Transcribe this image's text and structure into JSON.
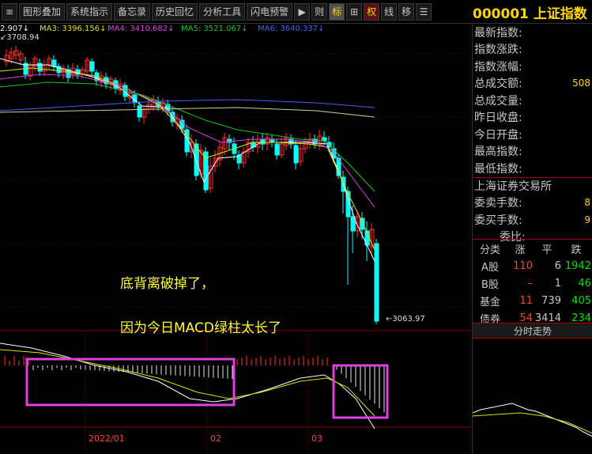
{
  "toolbar": {
    "buttons": [
      "图形叠加",
      "系统指示",
      "备忘录",
      "历史回忆",
      "分析工具",
      "闪电预警"
    ],
    "icons": {
      "play": "▶",
      "menu": "≡",
      "plus": "⊞",
      "list": "☰"
    },
    "mini_buttons": [
      "则",
      "标",
      "权",
      "线",
      "移"
    ],
    "index_title": "000001 上证指数"
  },
  "ma_bar": {
    "items": [
      {
        "label": "2.907↓",
        "color": "#ffffff"
      },
      {
        "label": "MA3: 3396.156↓",
        "color": "#e0e000"
      },
      {
        "label": "MA4: 3410.682↓",
        "color": "#e040e0"
      },
      {
        "label": "MA5: 3521.067↓",
        "color": "#20c020"
      },
      {
        "label": "MA6: 3640.337↓",
        "color": "#4060ff"
      }
    ],
    "price_tag": "3708.94",
    "low_tag": "3063.97"
  },
  "annotations": {
    "line1": "底背离破掉了，",
    "line2": "因为今日MACD绿柱太长了"
  },
  "dates": [
    "2022/01",
    "02",
    "03"
  ],
  "quote_panel": {
    "rows": [
      {
        "label": "最新指数:",
        "value": ""
      },
      {
        "label": "指数涨跌:",
        "value": ""
      },
      {
        "label": "指数涨幅:",
        "value": ""
      },
      {
        "label": "总成交额:",
        "value": "508"
      },
      {
        "label": "总成交量:",
        "value": ""
      },
      {
        "label": "昨日收盘:",
        "value": ""
      },
      {
        "label": "今日开盘:",
        "value": ""
      },
      {
        "label": "最高指数:",
        "value": ""
      },
      {
        "label": "最低指数:",
        "value": ""
      }
    ],
    "exchange": "上海证券交易所",
    "rows2": [
      {
        "label": "委卖手数:",
        "value": "8"
      },
      {
        "label": "委买手数:",
        "value": "9"
      },
      {
        "label": "委比:",
        "value": ""
      }
    ]
  },
  "rise_fall_table": {
    "headers": [
      "分类",
      "涨",
      "平",
      "跌"
    ],
    "rows": [
      [
        "A股",
        "110",
        "6",
        "1942"
      ],
      [
        "B股",
        "–",
        "1",
        "46"
      ],
      [
        "基金",
        "11",
        "739",
        "405"
      ],
      [
        "债券",
        "54",
        "3414",
        "234"
      ]
    ]
  },
  "minute_button": "分时走势",
  "colors": {
    "up": "#ff3030",
    "down": "#00ffff",
    "annotation": "#ffff33",
    "macd_box": "#e040e0"
  }
}
